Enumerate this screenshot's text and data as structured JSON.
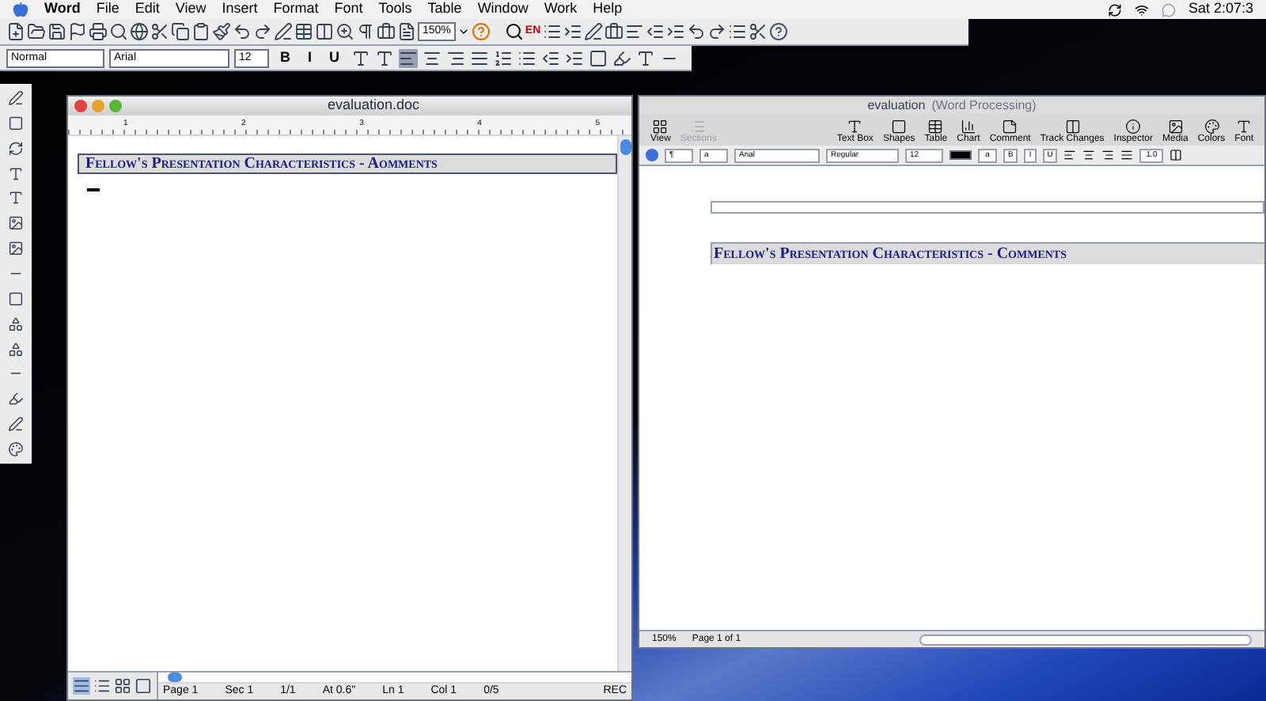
{
  "menu_bar": {
    "app": "Word",
    "items": [
      "File",
      "Edit",
      "View",
      "Insert",
      "Format",
      "Font",
      "Tools",
      "Table",
      "Window",
      "Work",
      "Help"
    ],
    "clock": "Sat 2:07:3"
  },
  "standard_toolbar": {
    "zoom": "150%",
    "language": "EN"
  },
  "formatting_toolbar": {
    "style": "Normal",
    "font": "Arial",
    "size": "12",
    "buttons": [
      "B",
      "I",
      "U"
    ]
  },
  "word_window": {
    "title": "evaluation.doc",
    "ruler_numbers": [
      "1",
      "2",
      "3",
      "4",
      "5"
    ],
    "heading": "Fellow's Presentation Characteristics - Aomments",
    "status_bar": [
      "Page 1",
      "Sec 1",
      "1/1",
      "At 0.6\"",
      "Ln 1",
      "Col 1",
      "0/5"
    ],
    "rec": "REC"
  },
  "pages_window": {
    "title": "evaluation",
    "subtitle": "(Word Processing)",
    "toolbar": [
      {
        "label": "View",
        "disabled": false
      },
      {
        "label": "Sections",
        "disabled": true
      },
      {
        "label": "Text Box",
        "disabled": false
      },
      {
        "label": "Shapes",
        "disabled": false
      },
      {
        "label": "Table",
        "disabled": false
      },
      {
        "label": "Chart",
        "disabled": false
      },
      {
        "label": "Comment",
        "disabled": false
      },
      {
        "label": "Track Changes",
        "disabled": false
      },
      {
        "label": "Inspector",
        "disabled": false
      },
      {
        "label": "Media",
        "disabled": false
      },
      {
        "label": "Colors",
        "disabled": false
      },
      {
        "label": "Font",
        "disabled": false
      }
    ],
    "format_bar": {
      "paragraph": "¶",
      "character": "a",
      "font": "Arial",
      "typeface": "Regular",
      "size": "12",
      "color_value": "a",
      "buttons": [
        "B",
        "I",
        "U"
      ],
      "spacing": "1.0"
    },
    "heading": "Fellow's Presentation Characteristics - Comments",
    "zoom": "150%",
    "page": "Page 1 of 1"
  }
}
